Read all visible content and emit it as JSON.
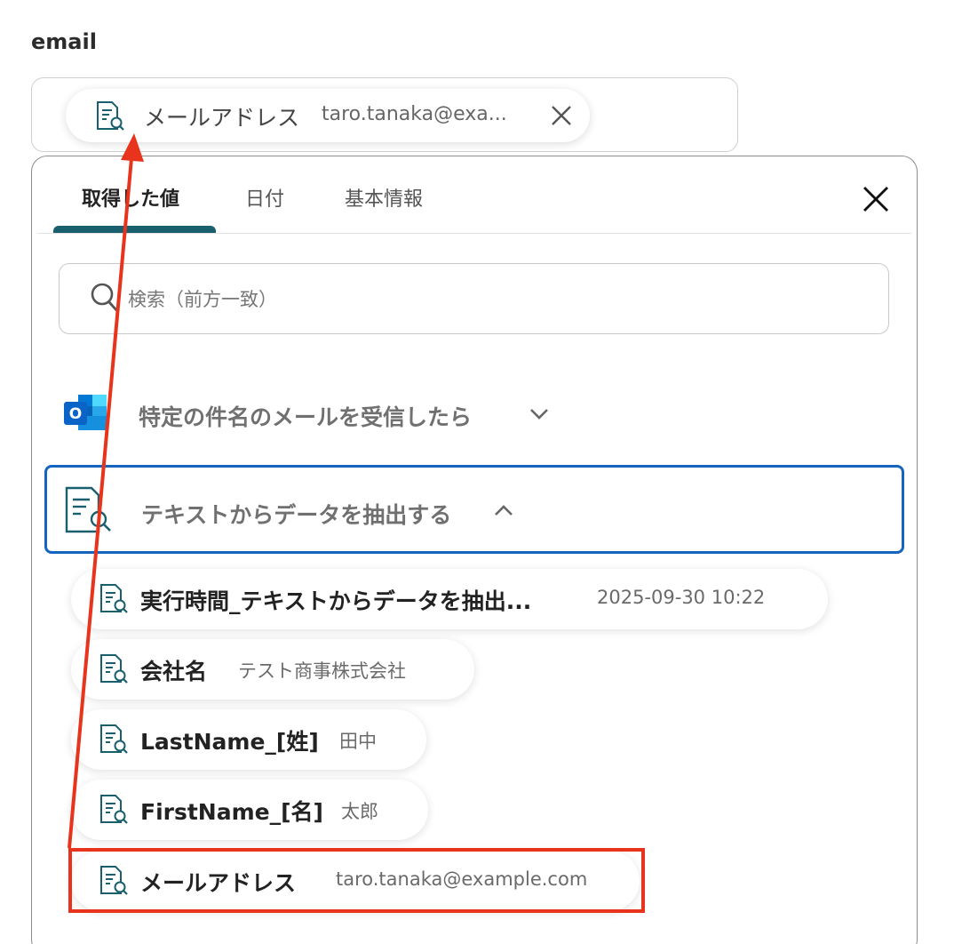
{
  "field": {
    "label": "email",
    "chip_label": "メールアドレス",
    "chip_value": "taro.tanaka@exa..."
  },
  "tabs": [
    {
      "label": "取得した値",
      "active": true
    },
    {
      "label": "日付",
      "active": false
    },
    {
      "label": "基本情報",
      "active": false
    }
  ],
  "search": {
    "placeholder": "検索（前方一致）",
    "value": ""
  },
  "sections": [
    {
      "title": "特定の件名のメールを受信したら",
      "icon": "outlook-icon",
      "expanded": false
    },
    {
      "title": "テキストからデータを抽出する",
      "icon": "document-search-icon",
      "expanded": true
    }
  ],
  "items": [
    {
      "label": "実行時間_テキストからデータを抽出...",
      "value": "2025-09-30 10:22"
    },
    {
      "label": "会社名",
      "value": "テスト商事株式会社"
    },
    {
      "label": "LastName_[姓]",
      "value": "田中"
    },
    {
      "label": "FirstName_[名]",
      "value": "太郎"
    },
    {
      "label": "メールアドレス",
      "value": "taro.tanaka@example.com"
    }
  ],
  "colors": {
    "accent": "#1a5f6e",
    "selected_border": "#1565c0",
    "annotation": "#e8341c",
    "outlook_blue": "#0a64c8"
  }
}
